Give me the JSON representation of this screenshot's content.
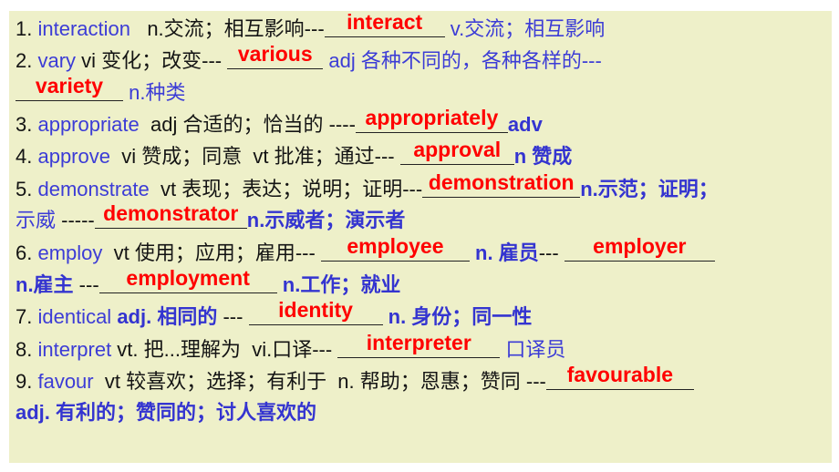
{
  "colors": {
    "background": "#eef0c9",
    "black_text": "#141414",
    "blue_text": "#3c3cd6",
    "answer_red": "#ff0000"
  },
  "lines": [
    {
      "segments": [
        {
          "text": "1. ",
          "style": "k"
        },
        {
          "text": "interaction",
          "style": "b"
        },
        {
          "text": "   n.交流；相互影响---",
          "style": "k"
        },
        {
          "answer": "interact",
          "style": "blank"
        },
        {
          "text": " v.交流；相互影响",
          "style": "b"
        }
      ]
    },
    {
      "segments": [
        {
          "text": "2. ",
          "style": "k"
        },
        {
          "text": "vary",
          "style": "b"
        },
        {
          "text": " vi 变化；改变--- ",
          "style": "k"
        },
        {
          "answer": "various",
          "style": "blank"
        },
        {
          "text": " adj 各种不同的，各种各样的---",
          "style": "b"
        }
      ]
    },
    {
      "segments": [
        {
          "answer": "variety",
          "style": "blank"
        },
        {
          "text": " n.种类",
          "style": "b"
        }
      ]
    },
    {
      "segments": [
        {
          "text": "3. ",
          "style": "k"
        },
        {
          "text": "appropriate",
          "style": "b"
        },
        {
          "text": "  adj 合适的；恰当的 ----",
          "style": "k"
        },
        {
          "answer": "appropriately",
          "style": "blank"
        },
        {
          "text": "adv",
          "style": "bb"
        }
      ]
    },
    {
      "segments": [
        {
          "text": "4. ",
          "style": "k"
        },
        {
          "text": "approve",
          "style": "b"
        },
        {
          "text": "  vi 赞成；同意  vt 批准；通过--- ",
          "style": "k"
        },
        {
          "answer": "approval",
          "style": "blank"
        },
        {
          "text": "n 赞成",
          "style": "bb"
        }
      ]
    },
    {
      "segments": [
        {
          "text": "5. ",
          "style": "k"
        },
        {
          "text": "demonstrate",
          "style": "b"
        },
        {
          "text": "  vt 表现；表达；说明；证明---",
          "style": "k"
        },
        {
          "answer": "demonstration",
          "style": "blank"
        },
        {
          "text": "n.示范；证明；",
          "style": "bb"
        }
      ]
    },
    {
      "segments": [
        {
          "text": "示威 ",
          "style": "b"
        },
        {
          "text": "-----",
          "style": "k"
        },
        {
          "answer": "demonstrator",
          "style": "blank"
        },
        {
          "text": "n.示威者；演示者",
          "style": "bb"
        }
      ]
    },
    {
      "segments": [
        {
          "text": "6. ",
          "style": "k"
        },
        {
          "text": "employ",
          "style": "b"
        },
        {
          "text": "  vt 使用；应用；雇用--- ",
          "style": "k"
        },
        {
          "answer": "employee",
          "style": "blank"
        },
        {
          "text": " n. 雇员",
          "style": "bb"
        },
        {
          "text": "--- ",
          "style": "k"
        },
        {
          "answer": "employer",
          "style": "blank"
        }
      ]
    },
    {
      "segments": [
        {
          "text": "n.雇主 ",
          "style": "bb"
        },
        {
          "text": "---",
          "style": "k"
        },
        {
          "answer": "employment",
          "style": "blank"
        },
        {
          "text": " n.工作；就业",
          "style": "bb"
        }
      ]
    },
    {
      "segments": [
        {
          "text": "7. ",
          "style": "k"
        },
        {
          "text": "identical ",
          "style": "b"
        },
        {
          "text": "adj. 相同的 ",
          "style": "bb"
        },
        {
          "text": "--- ",
          "style": "k"
        },
        {
          "answer": "identity",
          "style": "blank"
        },
        {
          "text": " n. 身份；同一性",
          "style": "bb"
        }
      ]
    },
    {
      "segments": [
        {
          "text": "8. ",
          "style": "k"
        },
        {
          "text": "interpret",
          "style": "b"
        },
        {
          "text": " vt. 把...理解为  vi.口译--- ",
          "style": "k"
        },
        {
          "answer": "interpreter",
          "style": "blank"
        },
        {
          "text": " 口译员",
          "style": "b"
        }
      ]
    },
    {
      "segments": [
        {
          "text": "9. ",
          "style": "k"
        },
        {
          "text": "favour",
          "style": "b"
        },
        {
          "text": "  vt 较喜欢；选择；有利于  n. 帮助；恩惠；赞同 ---",
          "style": "k"
        },
        {
          "answer": "favourable",
          "style": "blank"
        }
      ]
    },
    {
      "segments": [
        {
          "text": "adj. 有利的；赞同的；讨人喜欢的",
          "style": "bb"
        }
      ]
    }
  ]
}
